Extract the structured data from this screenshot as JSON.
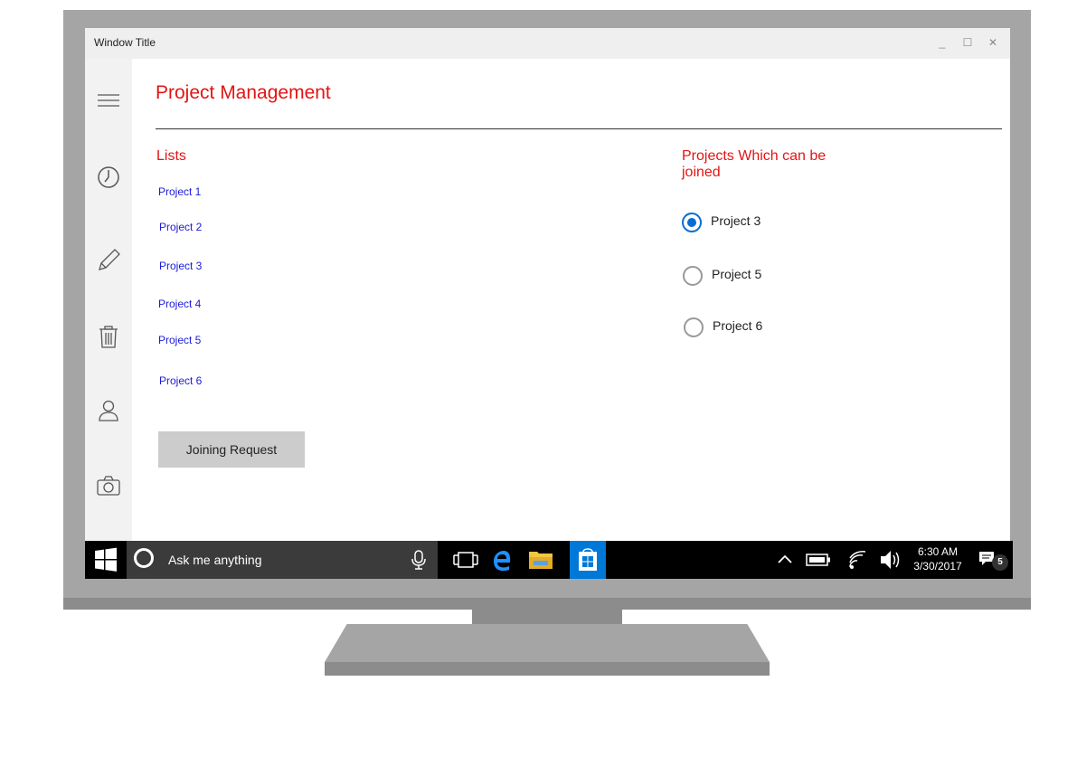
{
  "window": {
    "title": "Window Title",
    "minimize": "_",
    "maximize": "☐",
    "close": "✕"
  },
  "app": {
    "title": "Project Management"
  },
  "lists": {
    "heading": "Lists",
    "items": [
      "Project 1",
      "Project 2",
      "Project 3",
      "Project 4",
      "Project 5",
      "Project 6"
    ],
    "join_button": "Joining Request"
  },
  "joinable": {
    "heading": "Projects Which can be joined",
    "options": [
      "Project 3",
      "Project 5",
      "Project 6"
    ],
    "selected": "Project 3"
  },
  "nav_icons": [
    "hamburger-menu-icon",
    "clock-icon",
    "pencil-icon",
    "trash-icon",
    "user-icon",
    "camera-icon"
  ],
  "taskbar": {
    "search_placeholder": "Ask me anything",
    "time": "6:30 AM",
    "date": "3/30/2017",
    "notification_count": "5"
  },
  "colors": {
    "accent_red": "#e31414",
    "link_blue": "#1a1adb",
    "radio_blue": "#0a6ed1",
    "store_blue": "#0078d7"
  }
}
